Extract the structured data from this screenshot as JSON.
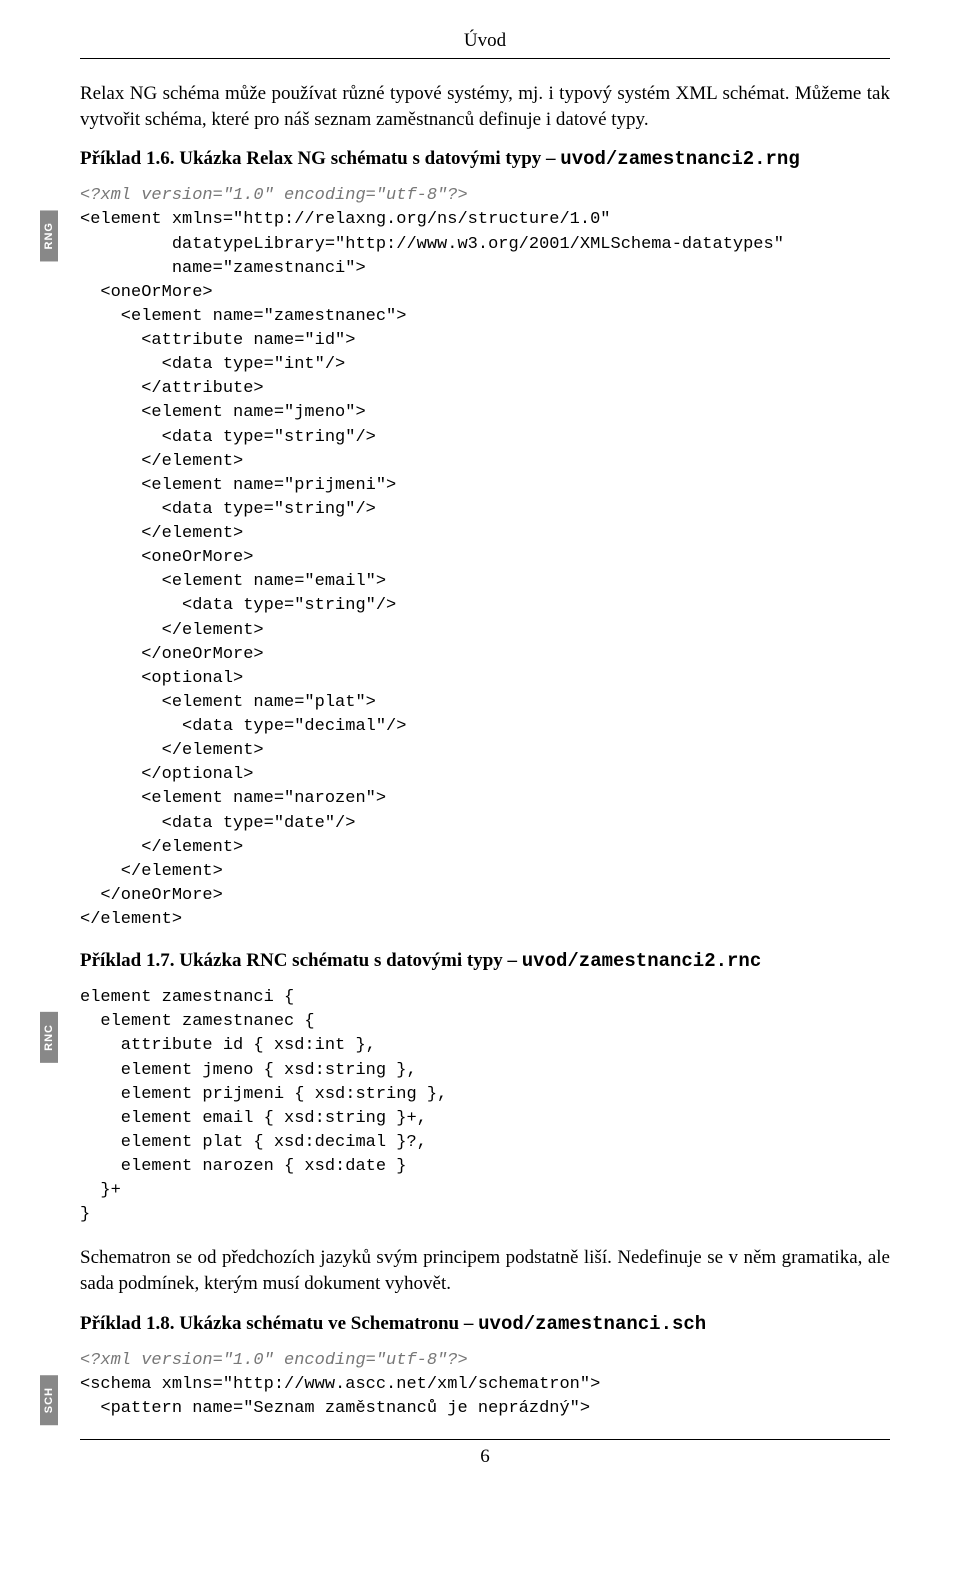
{
  "header": "Úvod",
  "intro_para": "Relax NG schéma může používat různé typové systémy, mj. i typový systém XML schémat. Můžeme tak vytvořit schéma, které pro náš seznam zaměstnanců definuje i datové typy.",
  "example1": {
    "heading_prefix": "Příklad 1.6. Ukázka Relax NG schématu s datovými typy – ",
    "heading_file": "uvod/zamestnanci2.rng",
    "badge": "RNG",
    "pi": "<?xml version=\"1.0\" encoding=\"utf-8\"?>",
    "code": "<element xmlns=\"http://relaxng.org/ns/structure/1.0\"\n         datatypeLibrary=\"http://www.w3.org/2001/XMLSchema-datatypes\"\n         name=\"zamestnanci\">\n  <oneOrMore>\n    <element name=\"zamestnanec\">\n      <attribute name=\"id\">\n        <data type=\"int\"/>\n      </attribute>\n      <element name=\"jmeno\">\n        <data type=\"string\"/>\n      </element>\n      <element name=\"prijmeni\">\n        <data type=\"string\"/>\n      </element>\n      <oneOrMore>\n        <element name=\"email\">\n          <data type=\"string\"/>\n        </element>\n      </oneOrMore>\n      <optional>\n        <element name=\"plat\">\n          <data type=\"decimal\"/>\n        </element>\n      </optional>\n      <element name=\"narozen\">\n        <data type=\"date\"/>\n      </element>\n    </element>\n  </oneOrMore>\n</element>"
  },
  "example2": {
    "heading_prefix": "Příklad 1.7. Ukázka RNC schématu s datovými typy – ",
    "heading_file": "uvod/zamestnanci2.rnc",
    "badge": "RNC",
    "code": "element zamestnanci {\n  element zamestnanec {\n    attribute id { xsd:int },\n    element jmeno { xsd:string },\n    element prijmeni { xsd:string },\n    element email { xsd:string }+,\n    element plat { xsd:decimal }?,\n    element narozen { xsd:date }\n  }+\n}"
  },
  "mid_para": "Schematron se od předchozích jazyků svým principem podstatně liší. Nedefinuje se v něm gramatika, ale sada podmínek, kterým musí dokument vyhovět.",
  "example3": {
    "heading_prefix": "Příklad 1.8. Ukázka schématu ve Schematronu – ",
    "heading_file": "uvod/zamestnanci.sch",
    "badge": "SCH",
    "pi": "<?xml version=\"1.0\" encoding=\"utf-8\"?>",
    "code": "<schema xmlns=\"http://www.ascc.net/xml/schematron\">\n  <pattern name=\"Seznam zaměstnanců je neprázdný\">"
  },
  "page_number": "6"
}
